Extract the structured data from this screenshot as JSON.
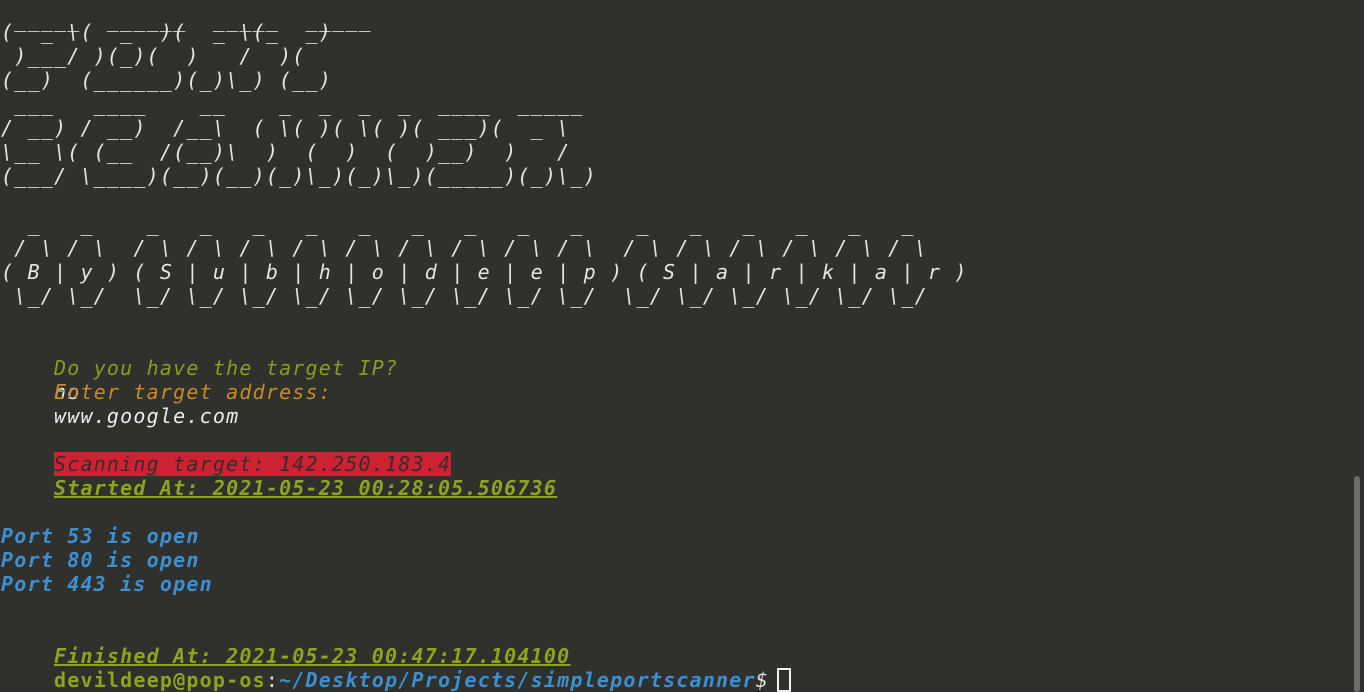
{
  "terminal": {
    "ascii_art": [
      " _____  ______  _____  _____ ",
      "(  _ \\(  _  )(  _ \\(_  _)",
      " )___/ )(_)(  )   /  )( ",
      "(__)  (______)(_)\\_) (__)",
      " ___   ____    __    _  _  _  _  ____  _____ ",
      "/ __) / __)  /__\\  ( \\( )( \\( )( ___)(  _ \\",
      "\\__ \\( (__  /(__)\\  )  (  )  (  )__)  )   /",
      "(___/ \\____)(__)(__)(_)\\_)(_)\\_)(_____)(_)\\_)",
      "",
      "  _   _    _   _   _   _   _   _   _   _   _    _   _   _   _   _   _ ",
      " / \\ / \\  / \\ / \\ / \\ / \\ / \\ / \\ / \\ / \\ / \\  / \\ / \\ / \\ / \\ / \\ / \\",
      "( B | y ) ( S | u | b | h | o | d | e | e | p ) ( S | a | r | k | a | r )",
      " \\_/ \\_/  \\_/ \\_/ \\_/ \\_/ \\_/ \\_/ \\_/ \\_/ \\_/  \\_/ \\_/ \\_/ \\_/ \\_/ \\_/"
    ],
    "question_ip": "Do you have the target IP?",
    "answer_ip": "no",
    "question_address": "Enter target address:",
    "answer_address": "www.google.com",
    "scanning": "Scanning target: 142.250.183.4",
    "started": "Started At: 2021-05-23 00:28:05.506736",
    "ports": [
      "Port 53 is open",
      "Port 80 is open",
      "Port 443 is open"
    ],
    "finished": "Finished At: 2021-05-23 00:47:17.104100",
    "prompt": {
      "user": "devildeep@pop-os",
      "sep": ":",
      "path": "~/Desktop/Projects/simpleportscanner",
      "dollar": "$"
    }
  },
  "colors": {
    "background": "#30302c",
    "olive": "#8a9b24",
    "orange": "#c68a2b",
    "red_highlight": "#cc2233",
    "green": "#8ea31f",
    "blue": "#3d8fd0"
  }
}
